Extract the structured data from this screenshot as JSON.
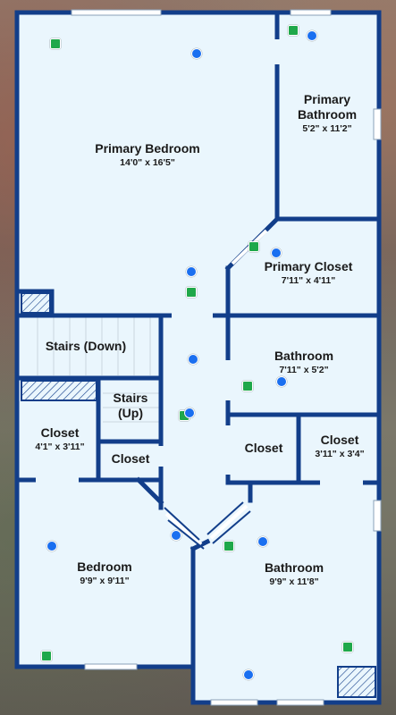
{
  "rooms": {
    "primary_bedroom": {
      "name": "Primary Bedroom",
      "dim": "14'0\" x 16'5\""
    },
    "primary_bathroom": {
      "name": "Primary\nBathroom",
      "dim": "5'2\" x 11'2\""
    },
    "primary_closet": {
      "name": "Primary Closet",
      "dim": "7'11\" x 4'11\""
    },
    "stairs_down": {
      "name": "Stairs (Down)"
    },
    "bathroom_mid": {
      "name": "Bathroom",
      "dim": "7'11\" x 5'2\""
    },
    "stairs_up": {
      "name": "Stairs\n(Up)"
    },
    "closet_left": {
      "name": "Closet",
      "dim": "4'1\" x 3'11\""
    },
    "closet_small": {
      "name": "Closet"
    },
    "closet_center": {
      "name": "Closet"
    },
    "closet_right": {
      "name": "Closet",
      "dim": "3'11\" x 3'4\""
    },
    "bedroom": {
      "name": "Bedroom",
      "dim": "9'9\" x 9'11\""
    },
    "bathroom_bottom": {
      "name": "Bathroom",
      "dim": "9'9\" x 11'8\""
    }
  },
  "colors": {
    "wall": "#123e8a",
    "floor": "#eaf6fd",
    "blue_marker": "#1a6ff0",
    "green_marker": "#1fa84a"
  },
  "marker_legend": {
    "blue": "blue-dot-marker",
    "green": "green-square-marker"
  }
}
